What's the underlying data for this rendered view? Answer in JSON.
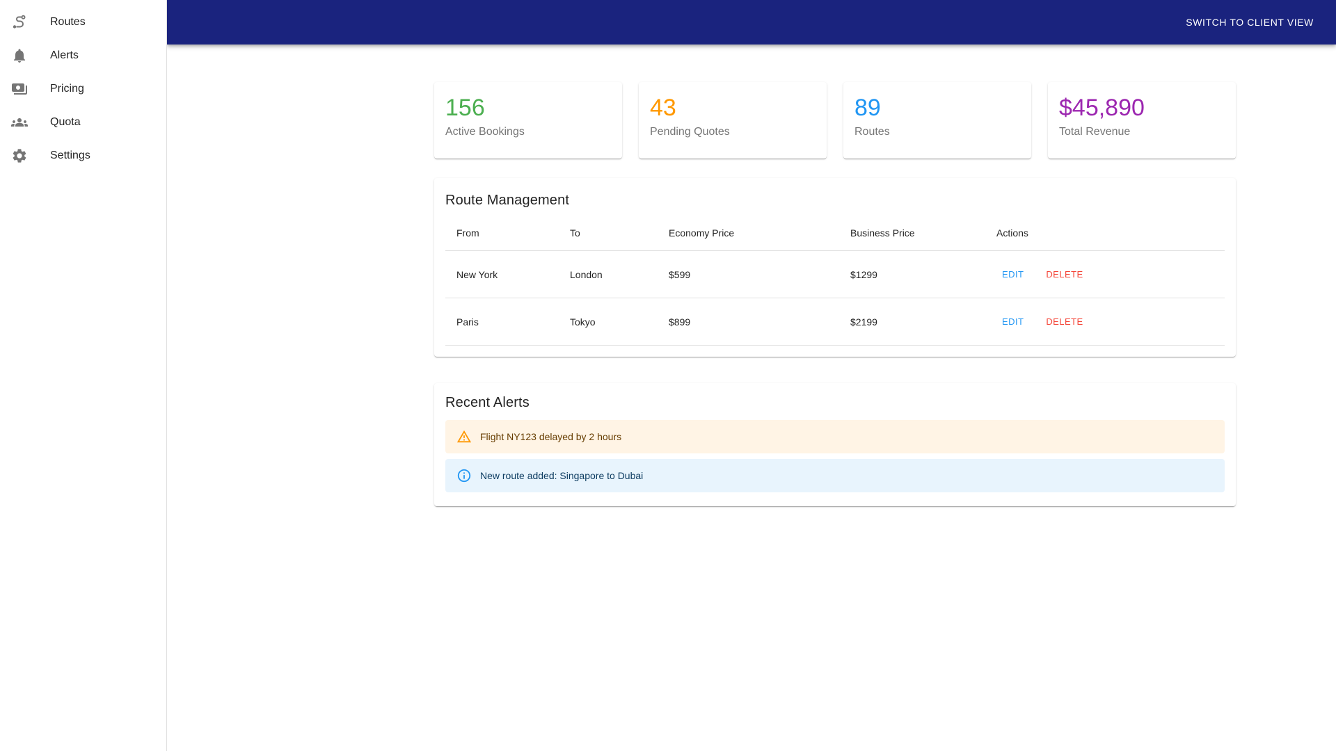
{
  "header": {
    "bg_color": "#1a237e",
    "switch_button_label": "SWITCH TO CLIENT VIEW"
  },
  "sidebar": {
    "items": [
      {
        "label": "Routes",
        "icon": "route-icon"
      },
      {
        "label": "Alerts",
        "icon": "bell-icon"
      },
      {
        "label": "Pricing",
        "icon": "money-icon"
      },
      {
        "label": "Quota",
        "icon": "people-icon"
      },
      {
        "label": "Settings",
        "icon": "gear-icon"
      }
    ]
  },
  "stats": [
    {
      "value": "156",
      "label": "Active Bookings",
      "color": "#4caf50"
    },
    {
      "value": "43",
      "label": "Pending Quotes",
      "color": "#ff9800"
    },
    {
      "value": "89",
      "label": "Routes",
      "color": "#2196f3"
    },
    {
      "value": "$45,890",
      "label": "Total Revenue",
      "color": "#9c27b0"
    }
  ],
  "route_management": {
    "title": "Route Management",
    "columns": [
      "From",
      "To",
      "Economy Price",
      "Business Price",
      "Actions"
    ],
    "rows": [
      {
        "from": "New York",
        "to": "London",
        "economy": "$599",
        "business": "$1299"
      },
      {
        "from": "Paris",
        "to": "Tokyo",
        "economy": "$899",
        "business": "$2199"
      }
    ],
    "edit_label": "EDIT",
    "delete_label": "DELETE",
    "edit_color": "#2196f3",
    "delete_color": "#f44336"
  },
  "recent_alerts": {
    "title": "Recent Alerts",
    "alerts": [
      {
        "type": "warning",
        "message": "Flight NY123 delayed by 2 hours",
        "bg": "#fff4e5",
        "text_color": "#663c00",
        "icon_color": "#ff9800"
      },
      {
        "type": "info",
        "message": "New route added: Singapore to Dubai",
        "bg": "#e8f4fd",
        "text_color": "#0d3c61",
        "icon_color": "#2196f3"
      }
    ]
  }
}
